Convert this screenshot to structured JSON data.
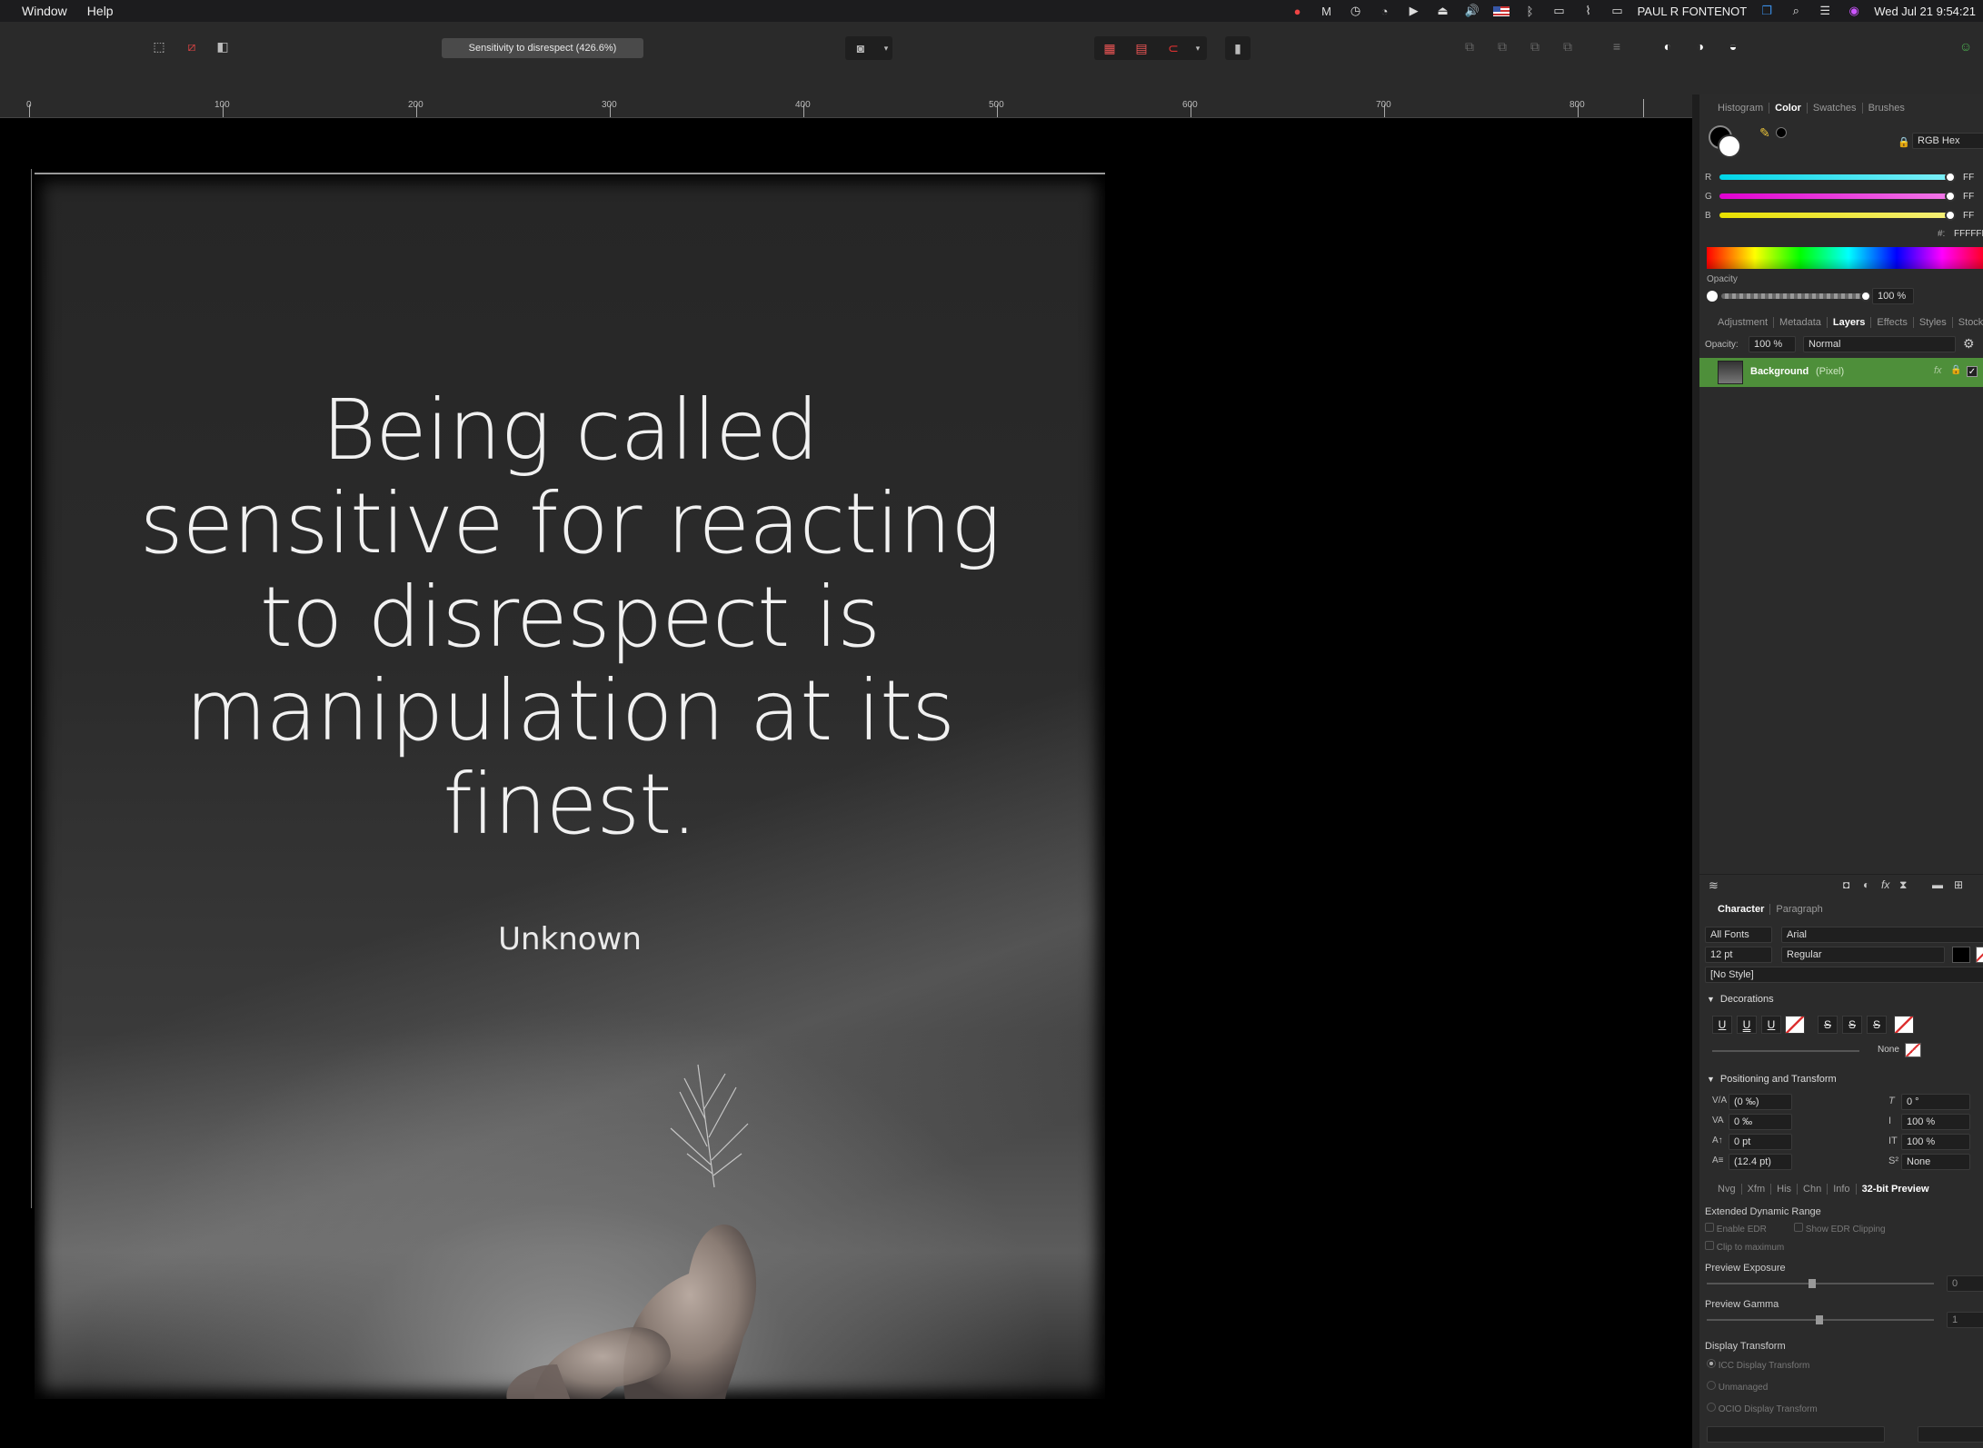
{
  "menubar": {
    "items": [
      "Window",
      "Help"
    ],
    "user": "PAUL R FONTENOT",
    "clock": "Wed Jul 21  9:54:21"
  },
  "toolbar": {
    "document_title": "Sensitivity to disrespect (426.6%)"
  },
  "ruler": {
    "labels": [
      "0",
      "100",
      "200",
      "300",
      "400",
      "500",
      "600",
      "700",
      "800"
    ]
  },
  "poster": {
    "quote_lines": [
      "Being called",
      "sensitive for reacting",
      "to disrespect is",
      "manipulation at its",
      "finest."
    ],
    "author": "Unknown"
  },
  "panel": {
    "color_tabs": [
      "Histogram",
      "Color",
      "Swatches",
      "Brushes"
    ],
    "color_tabs_active": "Color",
    "color_mode": "RGB Hex",
    "channels": [
      {
        "label": "R",
        "value": "FF",
        "color": "#22d3e6"
      },
      {
        "label": "G",
        "value": "FF",
        "color": "#e62ad8"
      },
      {
        "label": "B",
        "value": "FF",
        "color": "#e8e21a"
      }
    ],
    "hex_label": "#:",
    "hex_value": "FFFFFF",
    "opacity_label": "Opacity",
    "opacity_value": "100 %",
    "layer_tabs": [
      "Adjustment",
      "Metadata",
      "Layers",
      "Effects",
      "Styles",
      "Stock"
    ],
    "layer_tabs_active": "Layers",
    "layers_opacity_label": "Opacity:",
    "layers_opacity_value": "100 %",
    "blend_mode": "Normal",
    "layer_name": "Background",
    "layer_type": "(Pixel)",
    "layer_color": "#4e8f3a",
    "char_tabs": [
      "Character",
      "Paragraph"
    ],
    "char_tabs_active": "Character",
    "font_collection": "All Fonts",
    "font_family": "Arial",
    "font_size": "12 pt",
    "font_style": "Regular",
    "text_style": "[No Style]",
    "decorations_label": "Decorations",
    "decoration_line_value": "None",
    "positioning_label": "Positioning and Transform",
    "transform_left": [
      "(0 ‰)",
      "0 ‰",
      "0 pt",
      "(12.4 pt)"
    ],
    "transform_right": [
      "0 °",
      "100 %",
      "100 %",
      "None"
    ],
    "bottom_tabs": [
      "Nvg",
      "Xfm",
      "His",
      "Chn",
      "Info",
      "32-bit Preview"
    ],
    "bottom_tabs_active": "32-bit Preview",
    "edr_label": "Extended Dynamic Range",
    "enable_edr": "Enable EDR",
    "show_edr_clipping": "Show EDR Clipping",
    "clip_to_max": "Clip to maximum",
    "preview_exposure_label": "Preview Exposure",
    "preview_exposure_value": "0",
    "preview_gamma_label": "Preview Gamma",
    "preview_gamma_value": "1",
    "display_transform_label": "Display Transform",
    "display_transforms": [
      "ICC Display Transform",
      "Unmanaged",
      "OCIO Display Transform"
    ]
  }
}
